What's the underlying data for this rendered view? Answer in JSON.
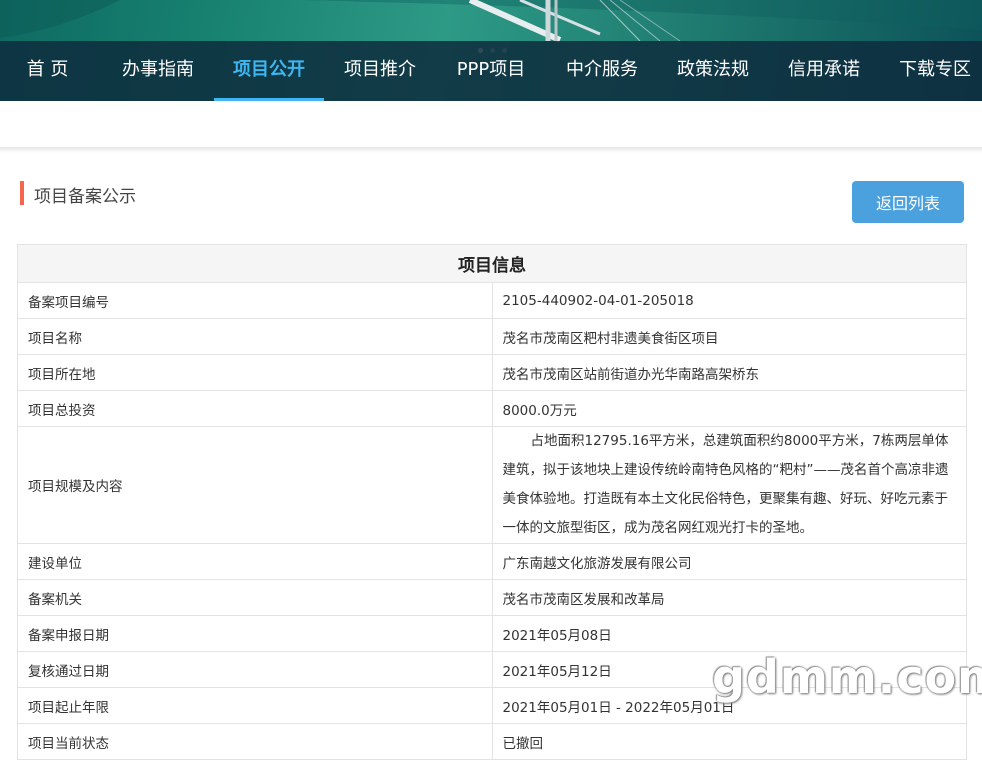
{
  "nav": {
    "items": [
      "首 页",
      "办事指南",
      "项目公开",
      "项目推介",
      "PPP项目",
      "中介服务",
      "政策法规",
      "信用承诺",
      "下载专区"
    ],
    "active_index": 2
  },
  "section": {
    "title": "项目备案公示",
    "back_button": "返回列表"
  },
  "table": {
    "heading": "项目信息",
    "rows": [
      {
        "label": "备案项目编号",
        "value": "2105-440902-04-01-205018"
      },
      {
        "label": "项目名称",
        "value": "茂名市茂南区粑村非遗美食街区项目"
      },
      {
        "label": "项目所在地",
        "value": "茂名市茂南区站前街道办光华南路高架桥东"
      },
      {
        "label": "项目总投资",
        "value": "8000.0万元"
      },
      {
        "label": "项目规模及内容",
        "value": "占地面积12795.16平方米，总建筑面积约8000平方米，7栋两层单体建筑，拟于该地块上建设传统岭南特色风格的“粑村”——茂名首个高凉非遗美食体验地。打造既有本土文化民俗特色，更聚集有趣、好玩、好吃元素于一体的文旅型街区，成为茂名网红观光打卡的圣地。"
      },
      {
        "label": "建设单位",
        "value": "广东南越文化旅游发展有限公司"
      },
      {
        "label": "备案机关",
        "value": "茂名市茂南区发展和改革局"
      },
      {
        "label": "备案申报日期",
        "value": "2021年05月08日"
      },
      {
        "label": "复核通过日期",
        "value": "2021年05月12日"
      },
      {
        "label": "项目起止年限",
        "value": "2021年05月01日 - 2022年05月01日"
      },
      {
        "label": "项目当前状态",
        "value": "已撤回"
      }
    ]
  },
  "watermark": "gdmm.com",
  "colors": {
    "nav_active": "#3fb6f2",
    "section_accent": "#f4674d",
    "button": "#4aa1dd"
  }
}
